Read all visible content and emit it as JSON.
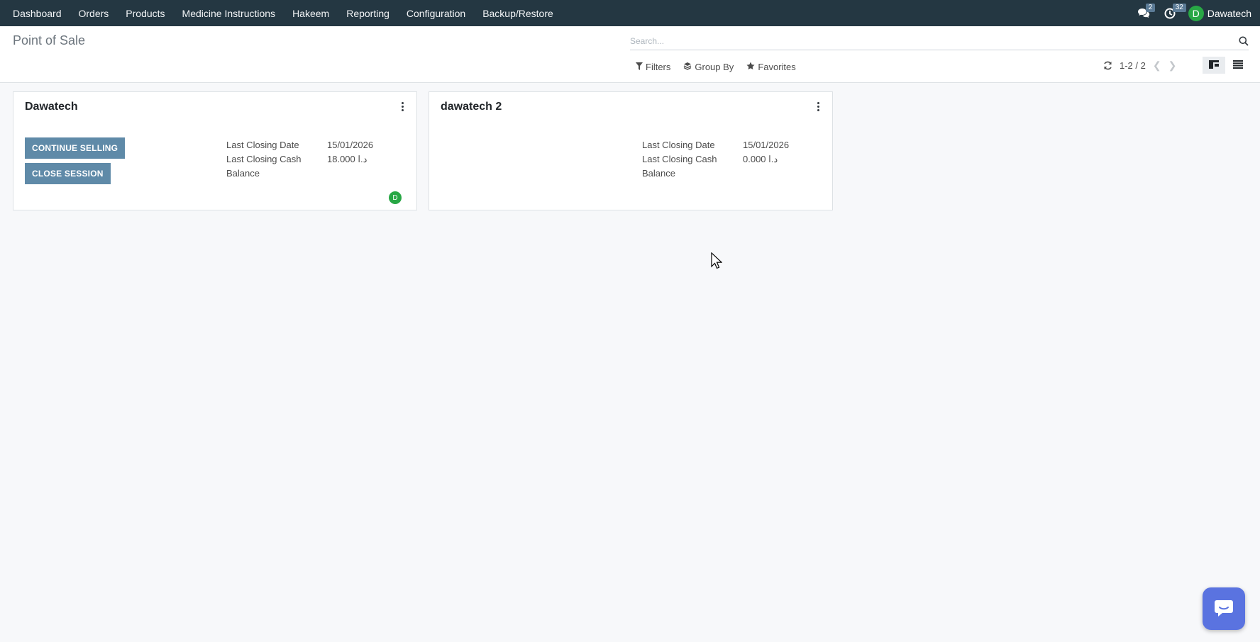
{
  "navbar": {
    "menu": [
      "Dashboard",
      "Orders",
      "Products",
      "Medicine Instructions",
      "Hakeem",
      "Reporting",
      "Configuration",
      "Backup/Restore"
    ],
    "messages_count": "2",
    "activities_count": "32",
    "user_initial": "D",
    "user_name": "Dawatech"
  },
  "control_panel": {
    "title": "Point of Sale",
    "search_placeholder": "Search...",
    "filters_label": "Filters",
    "group_by_label": "Group By",
    "favorites_label": "Favorites",
    "pager_value": "1-2 / 2"
  },
  "cards": [
    {
      "title": "Dawatech",
      "continue_label": "CONTINUE SELLING",
      "close_label": "CLOSE SESSION",
      "last_closing_date_label": "Last Closing Date",
      "last_closing_date": "15/01/2026",
      "last_closing_cash_label": "Last Closing Cash",
      "last_closing_cash_label2": "Balance",
      "last_closing_cash": "18.000 د.ا",
      "avatar_initial": "D"
    },
    {
      "title": "dawatech 2",
      "last_closing_date_label": "Last Closing Date",
      "last_closing_date": "15/01/2026",
      "last_closing_cash_label": "Last Closing Cash",
      "last_closing_cash_label2": "Balance",
      "last_closing_cash": "0.000 د.ا"
    }
  ],
  "colors": {
    "navbar_bg": "#243742",
    "primary_button": "#5f8aa8",
    "avatar": "#28a745",
    "chat_bubble": "#5a73e0"
  }
}
